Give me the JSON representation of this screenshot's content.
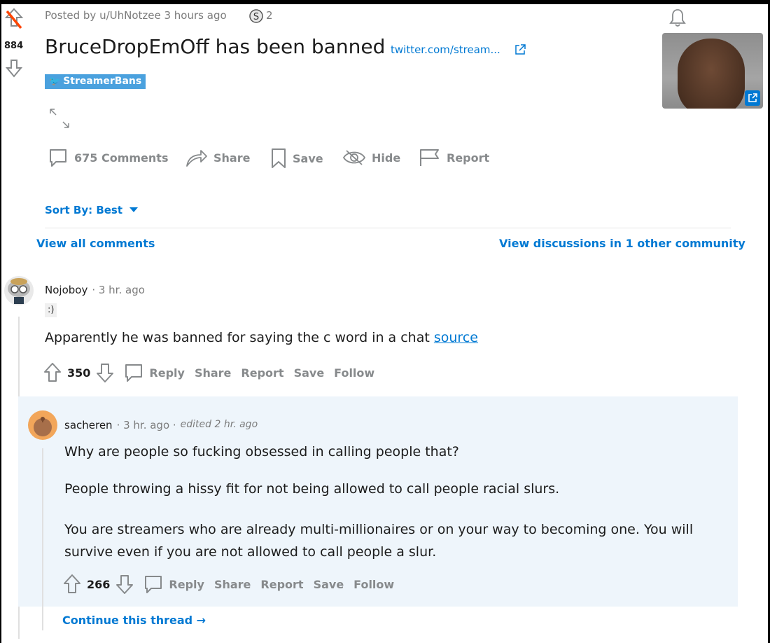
{
  "post": {
    "posted_by": "Posted by u/UhNotzee 3 hours ago",
    "award_count": "2",
    "score": "884",
    "title": "BruceDropEmOff has been banned",
    "domain": "twitter.com/stream...",
    "flair": "StreamerBans",
    "actions": {
      "comments": "675 Comments",
      "share": "Share",
      "save": "Save",
      "hide": "Hide",
      "report": "Report"
    }
  },
  "sort": {
    "label": "Sort By: Best"
  },
  "links": {
    "view_all": "View all comments",
    "view_discussions": "View discussions in 1 other community"
  },
  "comments": [
    {
      "author": "Nojoboy",
      "meta": "· 3 hr. ago",
      "flair": ":)",
      "body_text": "Apparently he was banned for saying the c word in a chat ",
      "body_link": "source",
      "score": "350",
      "actions": [
        "Reply",
        "Share",
        "Report",
        "Save",
        "Follow"
      ]
    },
    {
      "author": "sacheren",
      "meta": "· 3 hr. ago ·",
      "edited": "edited 2 hr. ago",
      "paragraphs": [
        "Why are people so fucking obsessed in calling people that?",
        "People throwing a hissy fit for not being allowed to call people racial slurs.",
        "You are streamers who are already multi-millionaires or on your way to becoming one. You will survive even if you are not allowed to call people a slur."
      ],
      "score": "266",
      "actions": [
        "Reply",
        "Share",
        "Report",
        "Save",
        "Follow"
      ]
    }
  ],
  "continue_thread": "Continue this thread →",
  "colors": {
    "accent": "#0079d3",
    "flair_bg": "#4aa1de",
    "reply_bg": "#eef5fb",
    "upvote_red": "#ff4500"
  },
  "icons": [
    "upvote-icon",
    "downvote-icon",
    "award-icon",
    "bell-icon",
    "external-link-icon",
    "expand-icon",
    "comment-icon",
    "share-icon",
    "save-icon",
    "hide-icon",
    "report-icon",
    "chevron-down-icon"
  ]
}
